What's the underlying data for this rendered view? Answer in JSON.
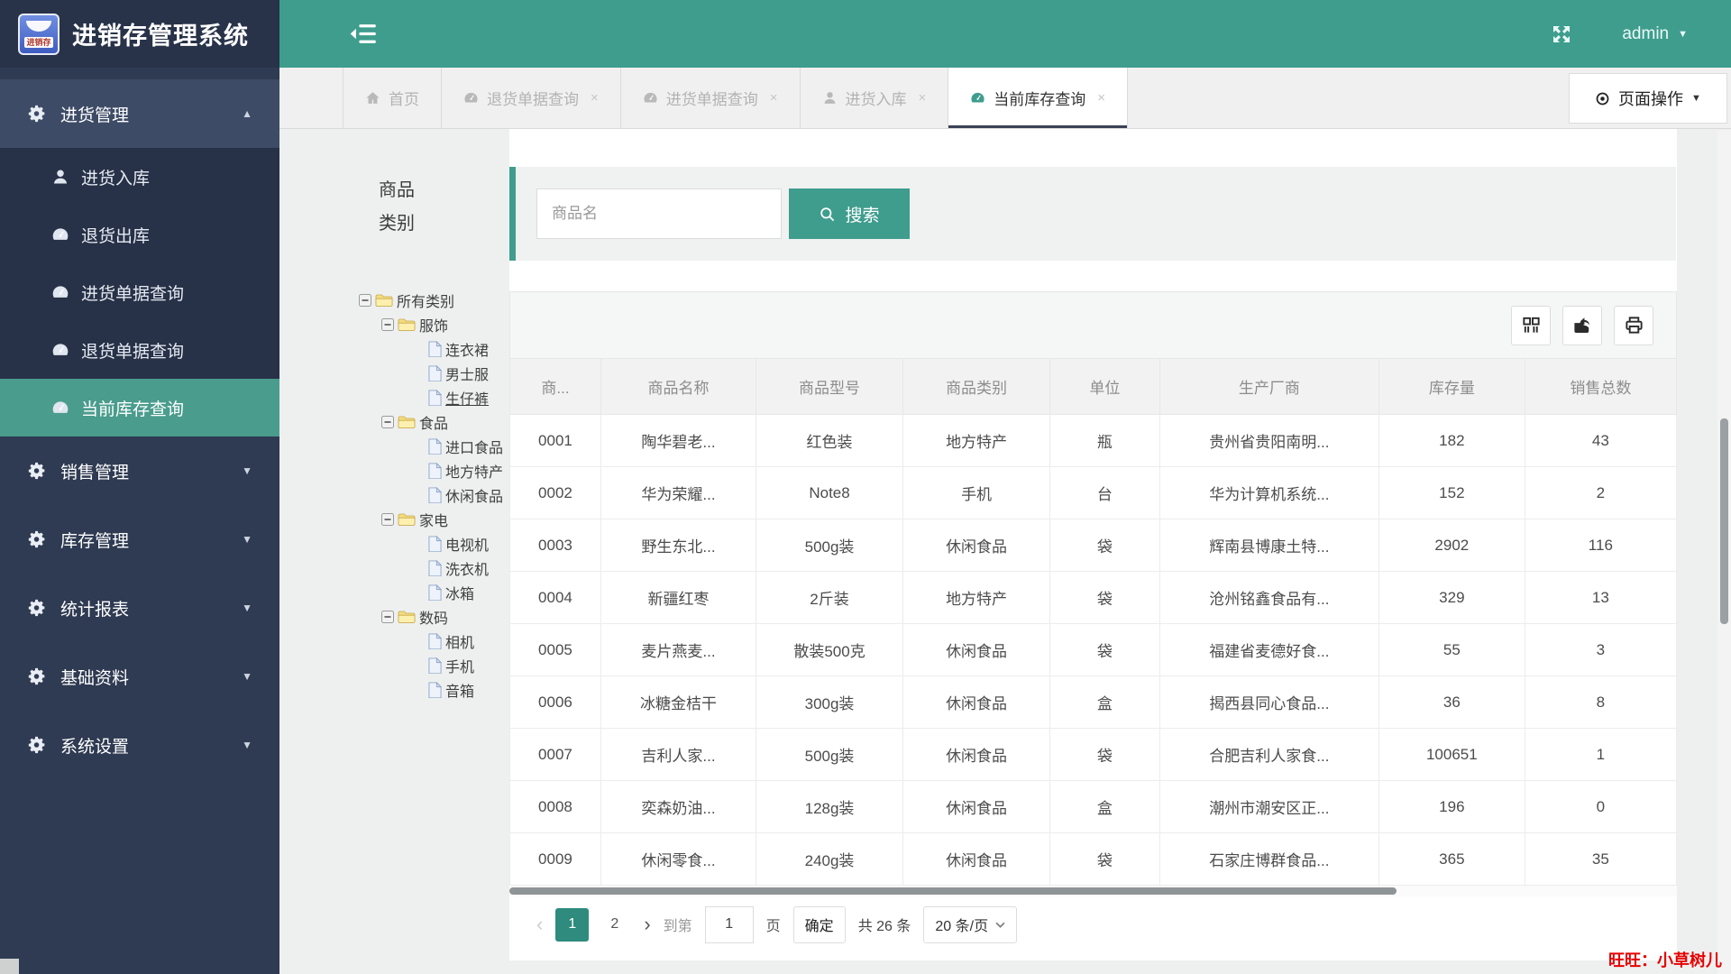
{
  "app": {
    "title": "进销存管理系统",
    "logo_text": "进销存"
  },
  "header": {
    "user": "admin"
  },
  "colors": {
    "topbar_accent": "#3f9d8e",
    "sidebar": "#2f3b52",
    "active_item": "#4a9c8d",
    "pagination_active": "#2e8b7d",
    "watermark_red": "#e60000",
    "logo_badge_blue": "#4c6ac8"
  },
  "sidebar": {
    "items": [
      {
        "key": "purchase-management",
        "label": "进货管理",
        "icon": "gears",
        "expanded": true,
        "children": [
          {
            "key": "purchase-inbound",
            "label": "进货入库",
            "icon": "user"
          },
          {
            "key": "return-outbound",
            "label": "退货出库",
            "icon": "gauge"
          },
          {
            "key": "purchase-orders-query",
            "label": "进货单据查询",
            "icon": "gauge"
          },
          {
            "key": "return-orders-query",
            "label": "退货单据查询",
            "icon": "gauge"
          },
          {
            "key": "current-stock-query",
            "label": "当前库存查询",
            "icon": "gauge",
            "active": true
          }
        ]
      },
      {
        "key": "sales-management",
        "label": "销售管理",
        "icon": "gears"
      },
      {
        "key": "stock-management",
        "label": "库存管理",
        "icon": "gears"
      },
      {
        "key": "report-statistics",
        "label": "统计报表",
        "icon": "gears"
      },
      {
        "key": "base-data",
        "label": "基础资料",
        "icon": "gears"
      },
      {
        "key": "system-settings",
        "label": "系统设置",
        "icon": "gears"
      }
    ]
  },
  "tabs": {
    "items": [
      {
        "key": "home",
        "label": "首页",
        "icon": "home",
        "closable": false
      },
      {
        "key": "return-orders-query",
        "label": "退货单据查询",
        "icon": "gauge",
        "closable": true
      },
      {
        "key": "purchase-orders-query",
        "label": "进货单据查询",
        "icon": "gauge",
        "closable": true
      },
      {
        "key": "purchase-inbound",
        "label": "进货入库",
        "icon": "user",
        "closable": true
      },
      {
        "key": "current-stock-query",
        "label": "当前库存查询",
        "icon": "gauge",
        "closable": true,
        "active": true
      }
    ],
    "close_glyph": "×",
    "page_actions": {
      "label": "页面操作",
      "icon": "target"
    }
  },
  "tree": {
    "title": "商品类别",
    "nodes": [
      {
        "key": "all-categories",
        "label": "所有类别",
        "level": 0,
        "type": "folder"
      },
      {
        "key": "clothing",
        "label": "服饰",
        "level": 1,
        "type": "folder"
      },
      {
        "key": "dress",
        "label": "连衣裙",
        "level": 2,
        "type": "file"
      },
      {
        "key": "mens",
        "label": "男士服",
        "level": 2,
        "type": "file"
      },
      {
        "key": "jeans",
        "label": "生仔裤",
        "level": 2,
        "type": "file",
        "underline": true
      },
      {
        "key": "food",
        "label": "食品",
        "level": 1,
        "type": "folder"
      },
      {
        "key": "imported",
        "label": "进口食品",
        "level": 2,
        "type": "file"
      },
      {
        "key": "local-specialty",
        "label": "地方特产",
        "level": 2,
        "type": "file"
      },
      {
        "key": "snack",
        "label": "休闲食品",
        "level": 2,
        "type": "file"
      },
      {
        "key": "appliance",
        "label": "家电",
        "level": 1,
        "type": "folder"
      },
      {
        "key": "tv",
        "label": "电视机",
        "level": 2,
        "type": "file"
      },
      {
        "key": "washer",
        "label": "洗衣机",
        "level": 2,
        "type": "file"
      },
      {
        "key": "fridge",
        "label": "冰箱",
        "level": 2,
        "type": "file"
      },
      {
        "key": "digital",
        "label": "数码",
        "level": 1,
        "type": "folder"
      },
      {
        "key": "camera",
        "label": "相机",
        "level": 2,
        "type": "file"
      },
      {
        "key": "phone",
        "label": "手机",
        "level": 2,
        "type": "file"
      },
      {
        "key": "speaker",
        "label": "音箱",
        "level": 2,
        "type": "file"
      }
    ]
  },
  "search": {
    "placeholder": "商品名",
    "button_label": "搜索"
  },
  "toolbar": {
    "buttons": [
      {
        "key": "columns"
      },
      {
        "key": "export"
      },
      {
        "key": "print"
      }
    ]
  },
  "table": {
    "columns": [
      "商...",
      "商品名称",
      "商品型号",
      "商品类别",
      "单位",
      "生产厂商",
      "库存量",
      "销售总数"
    ],
    "rows": [
      [
        "0001",
        "陶华碧老...",
        "红色装",
        "地方特产",
        "瓶",
        "贵州省贵阳南明...",
        "182",
        "43"
      ],
      [
        "0002",
        "华为荣耀...",
        "Note8",
        "手机",
        "台",
        "华为计算机系统...",
        "152",
        "2"
      ],
      [
        "0003",
        "野生东北...",
        "500g装",
        "休闲食品",
        "袋",
        "辉南县博康土特...",
        "2902",
        "116"
      ],
      [
        "0004",
        "新疆红枣",
        "2斤装",
        "地方特产",
        "袋",
        "沧州铭鑫食品有...",
        "329",
        "13"
      ],
      [
        "0005",
        "麦片燕麦...",
        "散装500克",
        "休闲食品",
        "袋",
        "福建省麦德好食...",
        "55",
        "3"
      ],
      [
        "0006",
        "冰糖金桔干",
        "300g装",
        "休闲食品",
        "盒",
        "揭西县同心食品...",
        "36",
        "8"
      ],
      [
        "0007",
        "吉利人家...",
        "500g装",
        "休闲食品",
        "袋",
        "合肥吉利人家食...",
        "100651",
        "1"
      ],
      [
        "0008",
        "奕森奶油...",
        "128g装",
        "休闲食品",
        "盒",
        "潮州市潮安区正...",
        "196",
        "0"
      ],
      [
        "0009",
        "休闲零食...",
        "240g装",
        "休闲食品",
        "袋",
        "石家庄博群食品...",
        "365",
        "35"
      ]
    ]
  },
  "pagination": {
    "prev_label": "‹",
    "next_label": "›",
    "pages": [
      "1",
      "2"
    ],
    "active_page": "1",
    "goto_label": "到第",
    "goto_value": "1",
    "goto_unit": "页",
    "confirm_label": "确定",
    "total_label": "共 26 条",
    "page_size_label": "20 条/页"
  },
  "watermark": "旺旺：小草树儿"
}
